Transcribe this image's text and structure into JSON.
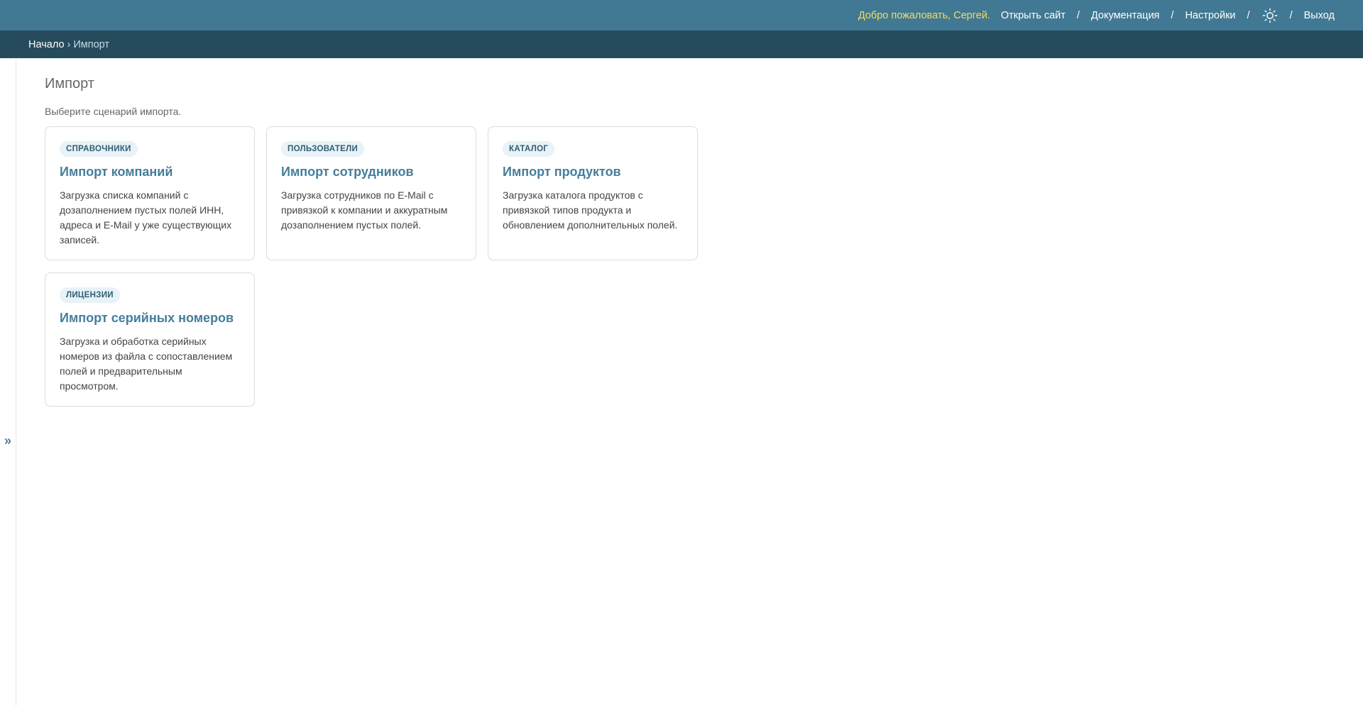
{
  "header": {
    "welcome": "Добро пожаловать, Сергей.",
    "links": {
      "open_site": "Открыть сайт",
      "docs": "Документация",
      "settings": "Настройки",
      "logout": "Выход"
    },
    "separator": "/",
    "theme_icon": "sun-icon"
  },
  "breadcrumbs": {
    "home": "Начало",
    "arrow": "›",
    "current": "Импорт"
  },
  "sidebar": {
    "toggle_icon": "»"
  },
  "page": {
    "title": "Импорт",
    "subtitle": "Выберите сценарий импорта."
  },
  "cards": [
    {
      "tag": "СПРАВОЧНИКИ",
      "title": "Импорт компаний",
      "description": "Загрузка списка компаний с дозаполнением пустых полей ИНН, адреса и E-Mail у уже существующих записей."
    },
    {
      "tag": "ПОЛЬЗОВАТЕЛИ",
      "title": "Импорт сотрудников",
      "description": "Загрузка сотрудников по E-Mail с привязкой к компании и аккуратным дозаполнением пустых полей."
    },
    {
      "tag": "КАТАЛОГ",
      "title": "Импорт продуктов",
      "description": "Загрузка каталога продуктов с привязкой типов продукта и обновлением дополнительных полей."
    },
    {
      "tag": "ЛИЦЕНЗИИ",
      "title": "Импорт серийных номеров",
      "description": "Загрузка и обработка серийных номеров из файла с сопоставлением полей и предварительным просмотром."
    }
  ],
  "colors": {
    "header_bg": "#417893",
    "breadcrumb_bg": "#264b5d",
    "welcome_text": "#f5dd5d",
    "card_title": "#447e9b",
    "tag_bg": "#e8f2f7"
  }
}
